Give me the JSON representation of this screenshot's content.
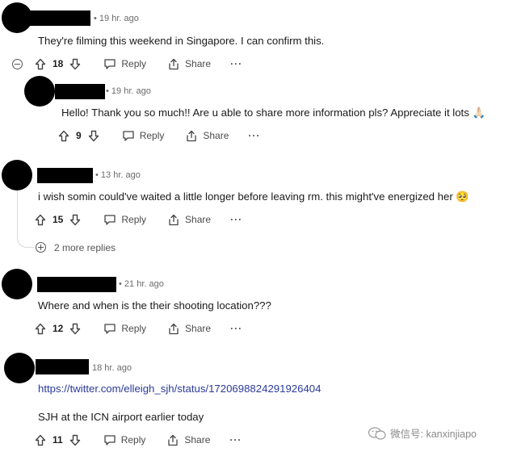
{
  "actions": {
    "reply_label": "Reply",
    "share_label": "Share",
    "more_label": "···"
  },
  "comments": [
    {
      "time": "• 19 hr. ago",
      "text": "They're filming this weekend in Singapore. I can confirm this.",
      "votes": "18"
    },
    {
      "time": "• 19 hr. ago",
      "text": "Hello! Thank you so much!! Are u able to share more information pls? Appreciate it lots 🙏🏻",
      "votes": "9"
    },
    {
      "time": "• 13 hr. ago",
      "text": "i wish somin could've waited a little longer before leaving rm. this might've energized her 🥺",
      "votes": "15",
      "more_replies": "2 more replies"
    },
    {
      "time": "• 21 hr. ago",
      "text": "Where and when is the their shooting location???",
      "votes": "12"
    },
    {
      "time": "18 hr. ago",
      "link": "https://twitter.com/elleigh_sjh/status/1720698824291926404",
      "text": "SJH at the ICN airport earlier today",
      "votes": "11"
    }
  ],
  "watermark": {
    "text": "微信号: kanxinjiapo"
  }
}
